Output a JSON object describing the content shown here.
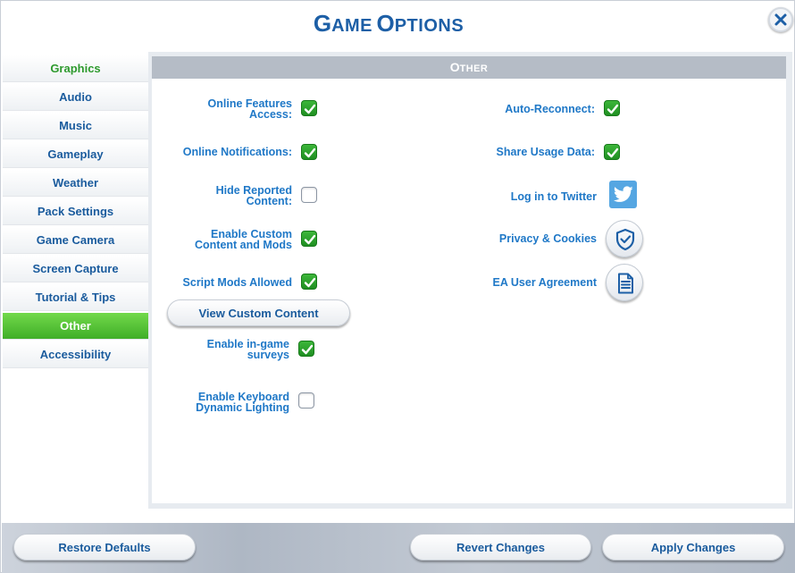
{
  "window": {
    "title_first": "G",
    "title_first_rest": "AME",
    "title_second": "O",
    "title_second_rest": "PTIONS"
  },
  "sidebar": {
    "items": [
      {
        "label": "Graphics"
      },
      {
        "label": "Audio"
      },
      {
        "label": "Music"
      },
      {
        "label": "Gameplay"
      },
      {
        "label": "Weather"
      },
      {
        "label": "Pack Settings"
      },
      {
        "label": "Game Camera"
      },
      {
        "label": "Screen Capture"
      },
      {
        "label": "Tutorial & Tips"
      },
      {
        "label": "Other",
        "selected": true
      },
      {
        "label": "Accessibility"
      }
    ]
  },
  "panel": {
    "header_first": "O",
    "header_rest": "THER",
    "left": {
      "online_features": {
        "line1": "Online Features",
        "line2": "Access:",
        "checked": true
      },
      "online_notifications": {
        "label": "Online Notifications:",
        "checked": true
      },
      "hide_reported": {
        "line1": "Hide Reported",
        "line2": "Content:",
        "checked": false
      },
      "custom_content": {
        "line1": "Enable Custom",
        "line2": "Content and Mods",
        "checked": true
      },
      "script_mods": {
        "label": "Script Mods Allowed",
        "checked": true
      },
      "view_custom_content_button": "View Custom Content",
      "surveys": {
        "line1": "Enable in-game",
        "line2": "surveys",
        "checked": true
      },
      "keyboard_lighting": {
        "line1": "Enable Keyboard",
        "line2": "Dynamic Lighting",
        "checked": false
      }
    },
    "right": {
      "auto_reconnect": {
        "label": "Auto-Reconnect:",
        "checked": true
      },
      "share_usage": {
        "label": "Share Usage Data:",
        "checked": true
      },
      "twitter": {
        "label": "Log in to Twitter",
        "icon": "twitter-icon"
      },
      "privacy": {
        "label": "Privacy & Cookies",
        "icon": "shield-check-icon"
      },
      "agreement": {
        "label": "EA User Agreement",
        "icon": "document-icon"
      }
    }
  },
  "footer": {
    "restore_defaults": "Restore Defaults",
    "revert_changes": "Revert Changes",
    "apply_changes": "Apply Changes"
  },
  "colors": {
    "title_blue": "#1d5fa6",
    "label_blue": "#1f78c7",
    "active_green": "#4cbc30",
    "check_green": "#2aa52c",
    "header_gray": "#b5bcc6",
    "twitter_blue": "#55a6e2"
  }
}
